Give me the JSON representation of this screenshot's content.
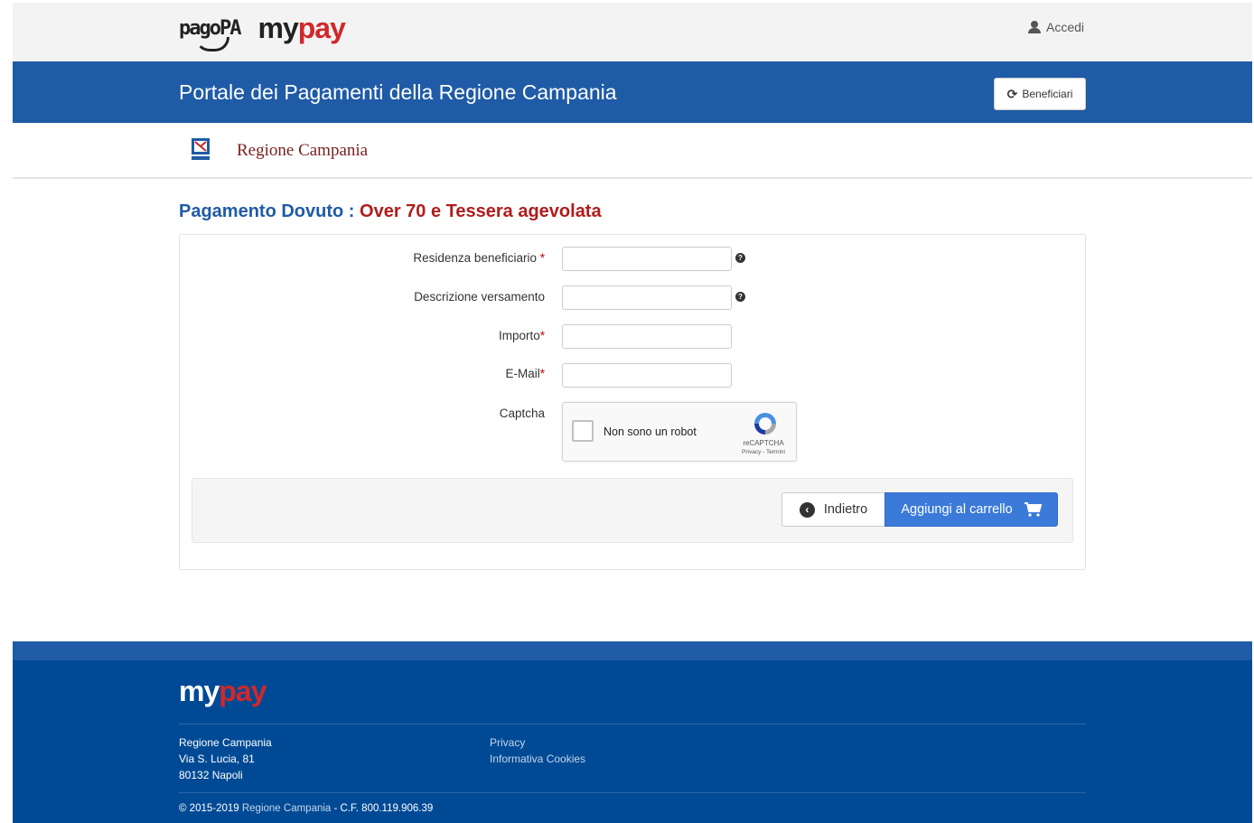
{
  "header": {
    "pagopa_logo": "pagoPA",
    "mypay_logo_my": "my",
    "mypay_logo_pay": "pay",
    "login_label": "Accedi"
  },
  "banner": {
    "title": "Portale dei Pagamenti della Regione Campania",
    "beneficiari_label": "Beneficiari"
  },
  "region": {
    "name": "Regione Campania"
  },
  "page": {
    "heading_prefix": "Pagamento Dovuto : ",
    "heading_subject": "Over 70 e Tessera agevolata"
  },
  "form": {
    "fields": [
      {
        "label": "Residenza beneficiario ",
        "required_mark": "*",
        "value": ""
      },
      {
        "label": "Descrizione versamento",
        "required_mark": "",
        "value": ""
      },
      {
        "label": "Importo",
        "required_mark": "*",
        "value": ""
      },
      {
        "label": "E-Mail",
        "required_mark": "*",
        "value": ""
      }
    ],
    "captcha_label": "Captcha",
    "captcha_checkbox_text": "Non sono un robot",
    "captcha_brand": "reCAPTCHA",
    "captcha_links": "Privacy - Termini",
    "back_label": "Indietro",
    "add_cart_label": "Aggiungi al carrello"
  },
  "footer": {
    "logo_my": "my",
    "logo_pay": "pay",
    "address": [
      "Regione Campania",
      "Via S. Lucia, 81",
      "80132 Napoli"
    ],
    "links": [
      "Privacy",
      "Informativa Cookies"
    ],
    "copyright_prefix": "© 2015-2019 ",
    "copyright_link": "Regione Campania",
    "copyright_suffix": " - C.F. 800.119.906.39"
  },
  "colors": {
    "banner_blue": "#1f5ba6",
    "footer_blue": "#004a95",
    "accent_red": "#b01c1c",
    "button_blue": "#3b7ad9",
    "pay_red": "#d0282b"
  },
  "icons": {
    "login": "user-icon",
    "beneficiari": "refresh-icon",
    "field_help": "info-icon",
    "back": "chevron-left-circle-icon",
    "cart": "cart-icon",
    "region": "region-crest-icon",
    "captcha": "recaptcha-logo-icon"
  }
}
